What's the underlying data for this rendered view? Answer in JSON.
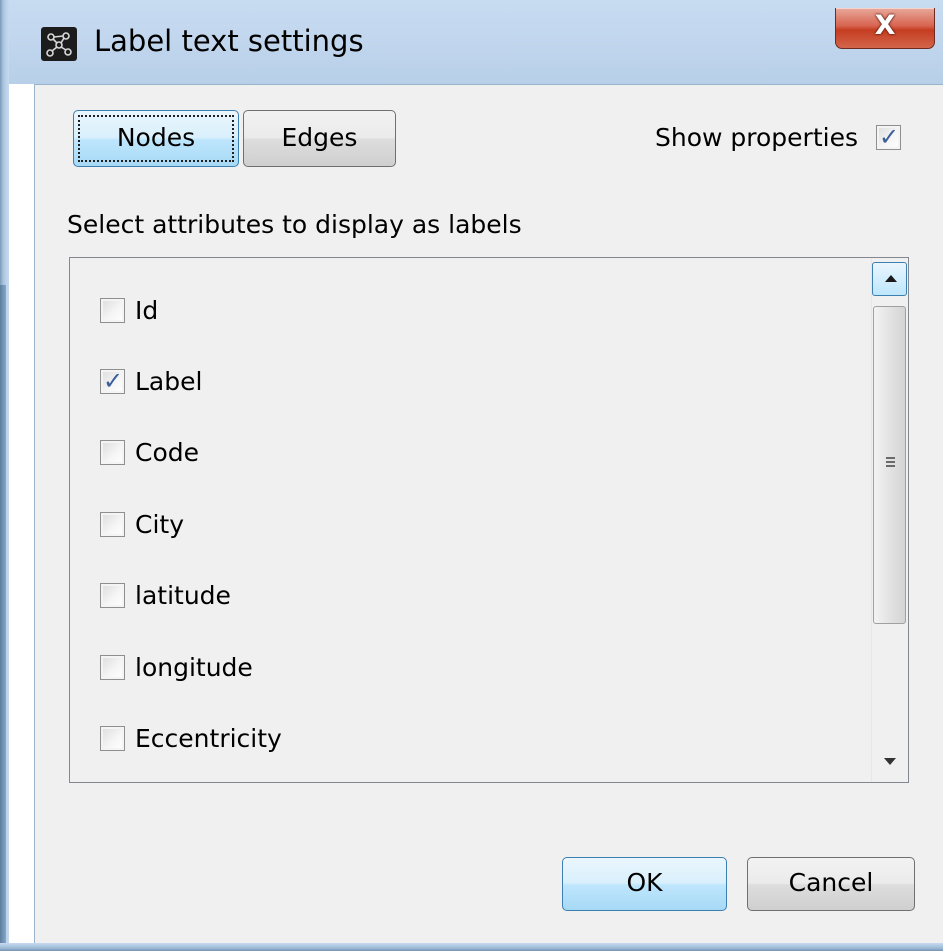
{
  "window": {
    "title": "Label text settings",
    "close_label": "X",
    "app_icon": "gephi-app-icon"
  },
  "tabs": {
    "nodes_label": "Nodes",
    "edges_label": "Edges",
    "active": "Nodes"
  },
  "show_properties": {
    "label": "Show properties",
    "checked": true
  },
  "attributes": {
    "heading": "Select attributes to display as labels",
    "items": [
      {
        "label": "Id",
        "checked": false
      },
      {
        "label": "Label",
        "checked": true
      },
      {
        "label": "Code",
        "checked": false
      },
      {
        "label": "City",
        "checked": false
      },
      {
        "label": "latitude",
        "checked": false
      },
      {
        "label": "longitude",
        "checked": false
      },
      {
        "label": "Eccentricity",
        "checked": false
      }
    ]
  },
  "footer": {
    "ok_label": "OK",
    "cancel_label": "Cancel"
  },
  "colors": {
    "accent_blue": "#3c7fb1",
    "close_red": "#c53d21",
    "dialog_bg": "#f0f0f0",
    "check_tick": "#3a5f9c"
  }
}
